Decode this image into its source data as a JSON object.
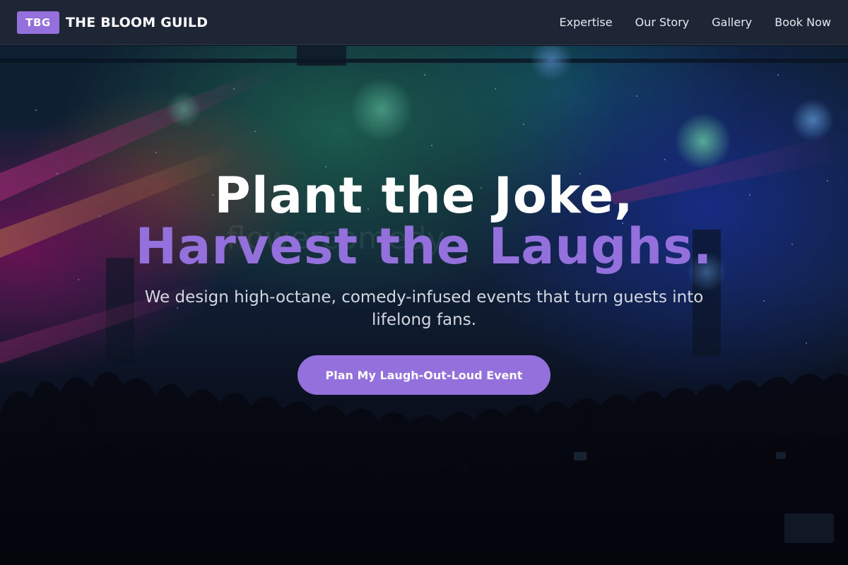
{
  "nav": {
    "brand_badge": "TBG",
    "brand_name": "THE BLOOM GUILD",
    "links": [
      "Expertise",
      "Our Story",
      "Gallery",
      "Book Now"
    ]
  },
  "hero": {
    "headline_line1": "Plant the Joke,",
    "headline_line2": "Harvest the Laughs.",
    "subtitle": "We design high-octane, comedy-infused events that turn guests into lifelong fans.",
    "cta_label": "Plan My Laugh-Out-Loud Event",
    "background_image": "concert-crowd-image",
    "watermark": "flowercomedy"
  },
  "colors": {
    "accent": "#9370db",
    "nav_bg": "#1e2636",
    "headline_white": "#ffffff",
    "subtitle": "#d4d7e0"
  }
}
